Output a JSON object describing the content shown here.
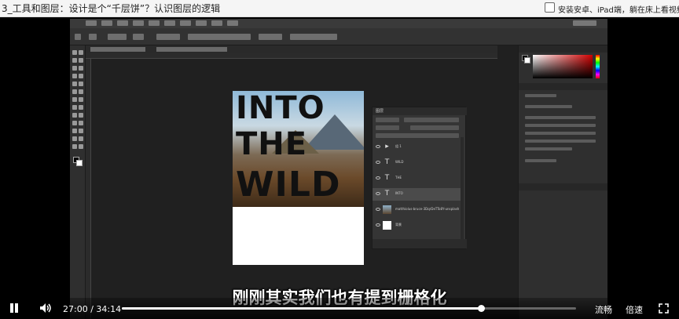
{
  "page": {
    "title": "3_工具和图层：设计是个“千层饼”？认识图层的逻辑",
    "option_label": "安装安卓、iPad端，躺在床上看视频"
  },
  "document": {
    "lines": [
      "INTO",
      "THE",
      "WILD"
    ]
  },
  "layers_panel": {
    "title": "图层",
    "layers": [
      {
        "kind": "group",
        "name": "组 1"
      },
      {
        "kind": "text",
        "name": "WILD"
      },
      {
        "kind": "text",
        "name": "THE"
      },
      {
        "kind": "text",
        "name": "INTO",
        "selected": true
      },
      {
        "kind": "image",
        "name": "matthiolus-bruce-3DqrDeTTo8Y-unsplash"
      },
      {
        "kind": "fill",
        "name": "背景"
      }
    ]
  },
  "subtitle": "刚刚其实我们也有提到栅格化",
  "player": {
    "current_time": "27:00",
    "separator": "/",
    "duration": "34:14",
    "progress": 0.79,
    "quality_label": "流畅",
    "speed_label": "倍速",
    "icons": {
      "play": "pause-icon",
      "volume": "volume-icon",
      "fullscreen": "fullscreen-icon"
    }
  }
}
